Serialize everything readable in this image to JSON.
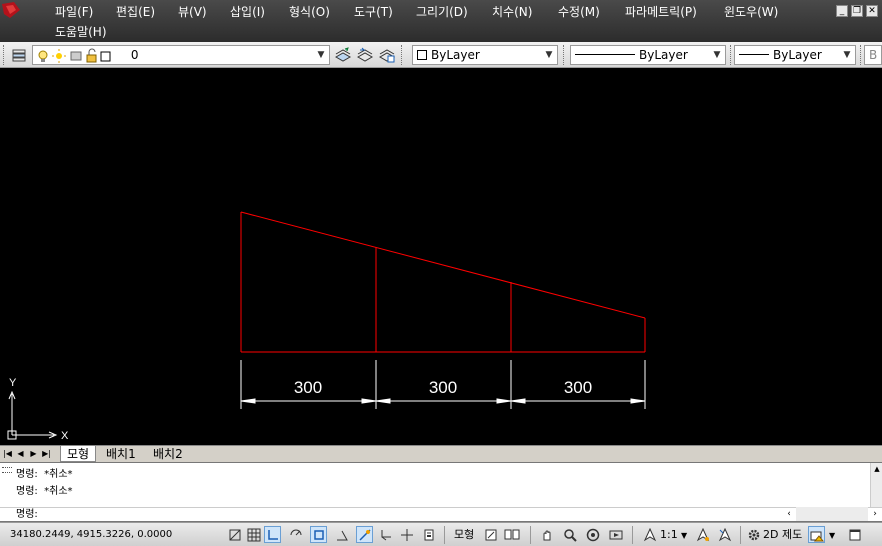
{
  "menu": {
    "items": [
      "파일(F)",
      "편집(E)",
      "뷰(V)",
      "삽입(I)",
      "형식(O)",
      "도구(T)",
      "그리기(D)",
      "치수(N)",
      "수정(M)",
      "파라메트릭(P)",
      "윈도우(W)"
    ],
    "help": "도움말(H)"
  },
  "toolbar": {
    "layer_value": "0",
    "color_value": "ByLayer",
    "linetype_value": "ByLayer",
    "lineweight_value": "ByLayer",
    "plotstyle_value": "B"
  },
  "drawing": {
    "dimensions": [
      {
        "text": "300",
        "length": 300
      },
      {
        "text": "300",
        "length": 300
      },
      {
        "text": "300",
        "length": 300
      }
    ],
    "ucs": {
      "x_label": "X",
      "y_label": "Y"
    },
    "colors": {
      "geometry": "#ff0000",
      "dimension": "#ffffff",
      "background": "#000000"
    }
  },
  "layout_tabs": [
    "모형",
    "배치1",
    "배치2"
  ],
  "command": {
    "history": [
      "명령:  *취소*",
      "명령:  *취소*"
    ],
    "prompt": "명령:"
  },
  "status": {
    "coordinates": "34180.2449, 4915.3226, 0.0000",
    "model_label": "모형",
    "scale_label": "1:1",
    "workspace_label": "2D 제도"
  },
  "icons": {
    "app": "autocad-logo-icon",
    "minimize": "minimize-icon",
    "restore": "restore-icon",
    "close": "close-icon"
  }
}
